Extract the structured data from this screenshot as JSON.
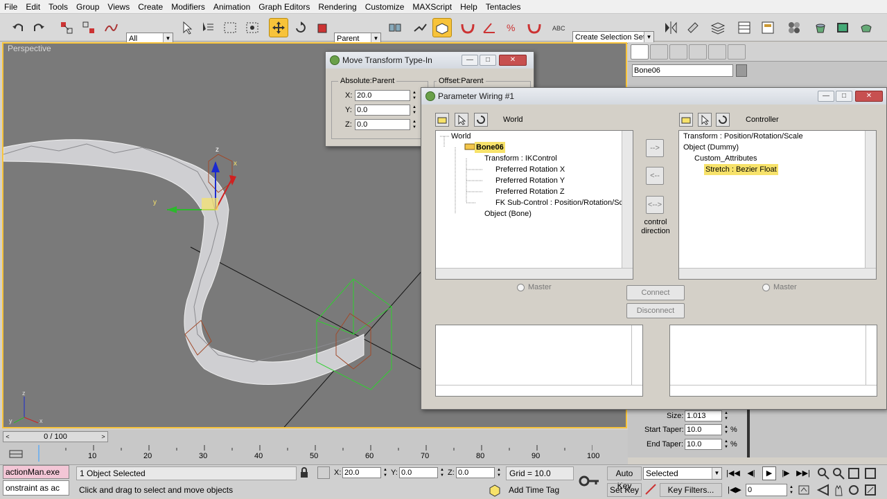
{
  "menu": [
    "File",
    "Edit",
    "Tools",
    "Group",
    "Views",
    "Create",
    "Modifiers",
    "Animation",
    "Graph Editors",
    "Rendering",
    "Customize",
    "MAXScript",
    "Help",
    "Tentacles"
  ],
  "toolbar": {
    "filter_value": "All",
    "coord_value": "Parent",
    "selection_set_placeholder": "Create Selection Set",
    "active_tool": "select-and-move"
  },
  "viewport": {
    "label": "Perspective",
    "gizmo_x": "x",
    "gizmo_y": "y",
    "gizmo_z": "z",
    "axis_tripod": {
      "x": "x",
      "y": "y",
      "z": "z"
    }
  },
  "move_dialog": {
    "title": "Move Transform Type-In",
    "absolute_group": "Absolute:Parent",
    "offset_group": "Offset:Parent",
    "x_label": "X:",
    "x_value": "20.0",
    "y_label": "Y:",
    "y_value": "0.0",
    "z_label": "Z:",
    "z_value": "0.0"
  },
  "wiring": {
    "title": "Parameter Wiring #1",
    "left_header": "World",
    "right_header": "Controller",
    "left_tree": [
      "World",
      "Bone06",
      "Transform : IKControl",
      "Preferred Rotation X",
      "Preferred Rotation Y",
      "Preferred Rotation Z",
      "FK Sub-Control : Position/Rotation/Sca",
      "Object (Bone)"
    ],
    "right_tree": [
      "Transform : Position/Rotation/Scale",
      "Object (Dummy)",
      "Custom_Attributes",
      "Stretch : Bezier Float"
    ],
    "arrow_right": "-->",
    "arrow_left": "<--",
    "arrow_both": "<-->",
    "control_direction": "control direction",
    "master_left": "Master",
    "master_right": "Master",
    "connect": "Connect",
    "disconnect": "Disconnect"
  },
  "cmdpanel": {
    "object_name": "Bone06",
    "size_label": "Size:",
    "size_value": "1.013",
    "start_taper_label": "Start Taper:",
    "start_taper_value": "10.0",
    "end_taper_label": "End Taper:",
    "end_taper_value": "10.0",
    "percent": "%"
  },
  "timeline": {
    "frame_counter": "0 / 100",
    "ticks": [
      "10",
      "20",
      "30",
      "40",
      "50",
      "60",
      "70",
      "80",
      "90",
      "100"
    ],
    "current_frame": 0,
    "frame_range": [
      0,
      100
    ]
  },
  "status": {
    "listener_line1": "actionMan.exe",
    "listener_line2": "onstraint as ac",
    "selected_text": "1 Object Selected",
    "prompt_text": "Click and drag to select and move objects",
    "x_label": "X:",
    "x_value": "20.0",
    "y_label": "Y:",
    "y_value": "0.0",
    "z_label": "Z:",
    "z_value": "0.0",
    "grid": "Grid = 10.0",
    "add_time_tag": "Add Time Tag",
    "auto_key": "Auto Key",
    "set_key": "Set Key",
    "selected_dropdown": "Selected",
    "key_filters": "Key Filters...",
    "frame_field": "0"
  }
}
